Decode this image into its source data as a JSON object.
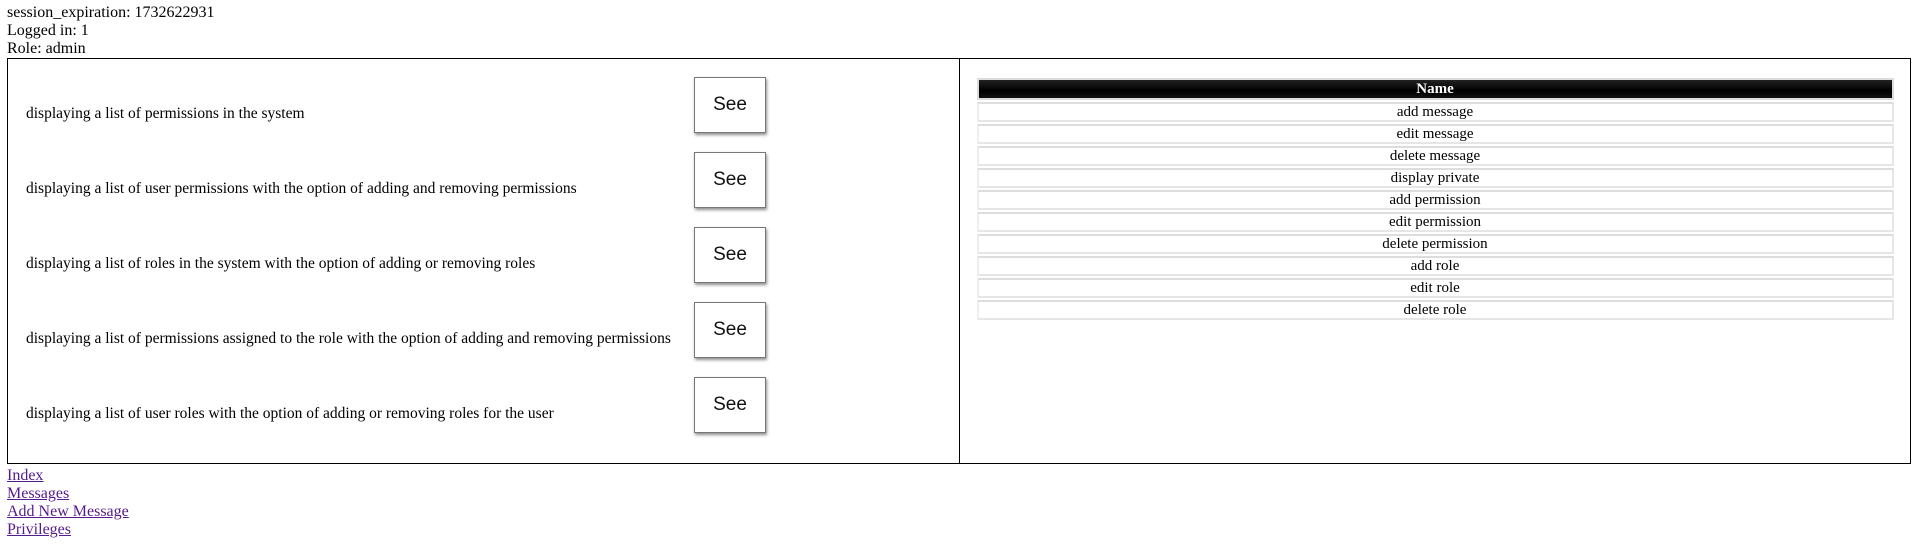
{
  "session": {
    "expiration_line": "session_expiration: 1732622931",
    "logged_in_line": "Logged in: 1",
    "role_line": "Role: admin"
  },
  "options": [
    {
      "text": "displaying a list of permissions in the system",
      "button_label": "See"
    },
    {
      "text": "displaying a list of user permissions with the option of adding and removing permissions",
      "button_label": "See"
    },
    {
      "text": "displaying a list of roles in the system with the option of adding or removing roles",
      "button_label": "See"
    },
    {
      "text": "displaying a list of permissions assigned to the role with the option of adding and removing permissions",
      "button_label": "See"
    },
    {
      "text": "displaying a list of user roles with the option of adding or removing roles for the user",
      "button_label": "See"
    }
  ],
  "permissions_table": {
    "header": "Name",
    "rows": [
      "add message",
      "edit message",
      "delete message",
      "display private",
      "add permission",
      "edit permission",
      "delete permission",
      "add role",
      "edit role",
      "delete role"
    ]
  },
  "nav": {
    "links": [
      "Index",
      "Messages",
      "Add New Message",
      "Privileges"
    ]
  },
  "colors": {
    "link": "#551a8b",
    "table_header_bg": "#000000",
    "table_header_text": "#ffffff"
  }
}
